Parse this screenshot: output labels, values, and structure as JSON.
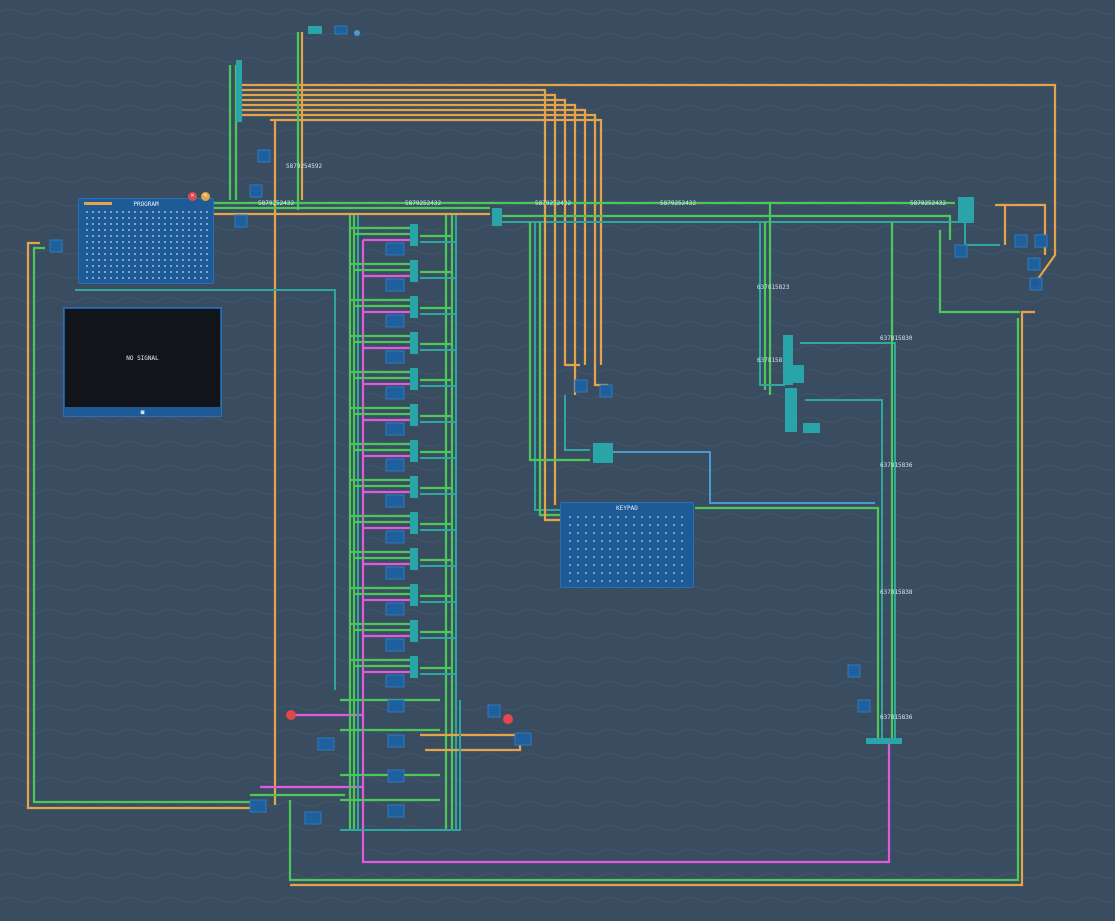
{
  "program_panel": {
    "title": "PROGRAM",
    "delete_icon": "trash-icon",
    "edit_icon": "pencil-icon"
  },
  "keypad_panel": {
    "title": "KEYPAD"
  },
  "display": {
    "status": "NO SIGNAL",
    "footer_icon": "display-icon"
  },
  "wire_labels": {
    "top_bus": "5879254592",
    "bus_a": "5879252432",
    "bus_b": "5879252432",
    "bus_c": "5879252432",
    "bus_d": "5879252432",
    "right_a": "5879252432",
    "mid_a": "637815823",
    "mid_b": "637815823",
    "mid_c": "637815830",
    "mid_d": "637815836",
    "mid_e": "637815838",
    "mid_f": "637815836"
  },
  "colors": {
    "background": "#3a4d60",
    "wire_orange": "#e6a44a",
    "wire_green": "#4cc85a",
    "wire_teal": "#2fa7a0",
    "wire_pink": "#e05ae0",
    "chip_blue": "#1e5a96"
  }
}
